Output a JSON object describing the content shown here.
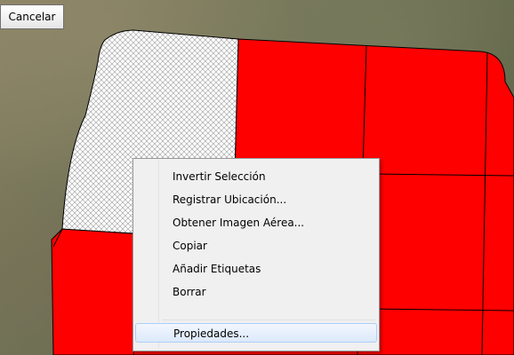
{
  "toolbar": {
    "cancel_label": "Cancelar"
  },
  "context_menu": {
    "items": [
      {
        "label": "Invertir Selección"
      },
      {
        "label": "Registrar Ubicación..."
      },
      {
        "label": "Obtener Imagen Aérea..."
      },
      {
        "label": "Copiar"
      },
      {
        "label": "Añadir Etiquetas"
      },
      {
        "label": "Borrar"
      },
      {
        "label": "Propiedades..."
      }
    ],
    "highlighted_item": "Propiedades..."
  },
  "colors": {
    "parcel_fill": "#ff0000",
    "selected_hatch": "#ffffff",
    "menu_background": "#f0f0f0",
    "menu_highlight": "#dce9fb"
  }
}
